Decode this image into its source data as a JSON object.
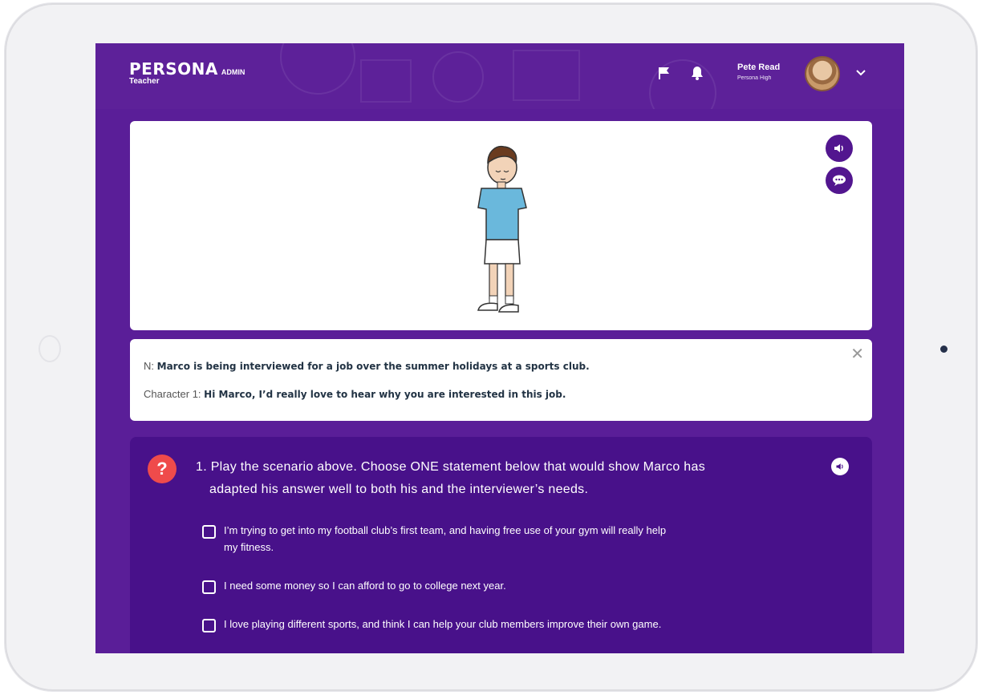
{
  "header": {
    "logo": "PERSONA",
    "admin_label": "ADMIN",
    "role": "Teacher",
    "user_name": "Pete Read",
    "user_school": "Persona High"
  },
  "dialogue": {
    "narrator_prefix": "N:",
    "narrator_text": "Marco is being interviewed for a job over the summer holidays at a sports club.",
    "character_prefix": "Character 1:",
    "character_text": "Hi Marco, I’d really love to hear why you are interested in this job."
  },
  "question": {
    "line1": "1. Play the scenario above. Choose ONE statement below that would show Marco has",
    "line2": "adapted his answer well to both his and the interviewer’s needs.",
    "options": [
      {
        "line1": "I’m trying to get into my football club’s first team, and having free use of your gym will really help",
        "line2": "my fitness."
      },
      {
        "line1": "I need some money so I can afford to go to college next year.",
        "line2": ""
      },
      {
        "line1": "I love playing different sports, and think I can help your club members improve their own game.",
        "line2": ""
      }
    ]
  },
  "icons": {
    "flag": "flag-icon",
    "bell": "bell-icon",
    "chevron": "chevron-down-icon",
    "audio": "speaker-icon",
    "speech": "speech-bubble-icon",
    "close": "close-icon",
    "help": "question-mark-icon"
  },
  "colors": {
    "brand_purple": "#5a1e98",
    "card_purple": "#48118a",
    "alert_red": "#ef4b4b"
  }
}
